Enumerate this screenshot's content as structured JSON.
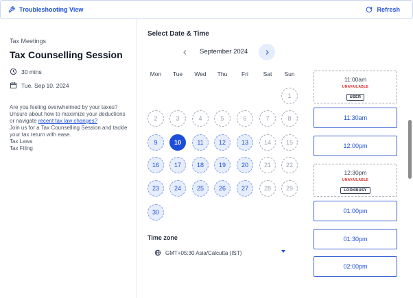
{
  "topbar": {
    "title": "Troubleshooting View",
    "refresh_label": "Refresh",
    "accent": "#1e4fd8"
  },
  "event": {
    "category": "Tax Meetings",
    "title": "Tax Counselling Session",
    "duration": "30 mins",
    "date": "Tue, Sep 10, 2024",
    "desc_1": "Are you feeling overwhelmed by your taxes? Unsure about how to maximize your deductions or navigate ",
    "desc_link": "recent tax law changes?",
    "desc_2": "Join us for a Tax Counselling Session and tackle your tax return with ease.",
    "tag_1": "Tax Laws",
    "tag_2": "Tax Filing"
  },
  "calendar": {
    "heading": "Select Date & Time",
    "month": "September 2024",
    "weekdays": [
      "Mon",
      "Tue",
      "Wed",
      "Thu",
      "Fri",
      "Sat",
      "Sun"
    ],
    "first_day_column": 6,
    "days_in_month": 30,
    "selected_day": 10,
    "available_days": [
      9,
      10,
      11,
      12,
      13,
      16,
      17,
      18,
      19,
      20,
      23,
      24,
      25,
      26,
      27,
      30
    ]
  },
  "timezone": {
    "label": "Time zone",
    "value": "GMT+05:30 Asia/Calcutta (IST)"
  },
  "slots": [
    {
      "time": "11:00am",
      "status": "unavailable",
      "status_label": "UNAVAILABLE",
      "badge": "USER"
    },
    {
      "time": "11:30am",
      "status": "available"
    },
    {
      "time": "12:00pm",
      "status": "available"
    },
    {
      "time": "12:30pm",
      "status": "unavailable",
      "status_label": "UNAVAILABLE",
      "badge": "LOOKBUSY"
    },
    {
      "time": "01:00pm",
      "status": "available"
    },
    {
      "time": "01:30pm",
      "status": "available"
    },
    {
      "time": "02:00pm",
      "status": "available"
    }
  ],
  "icons": {
    "topbar_left": "wrench-icon",
    "topbar_right": "refresh-icon",
    "duration": "clock-icon",
    "date": "calendar-icon",
    "timezone": "globe-icon",
    "prev": "chevron-left-icon",
    "next": "chevron-right-icon"
  }
}
